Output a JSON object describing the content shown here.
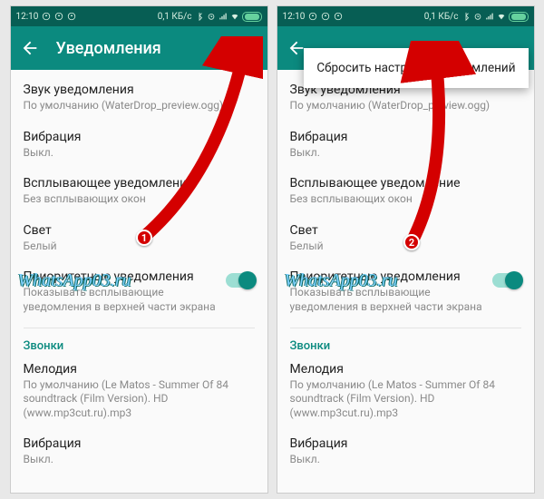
{
  "statusbar": {
    "time": "12:10",
    "network": "0,1 КБ/с"
  },
  "appbar": {
    "title": "Уведомления",
    "menu_reset": "Сбросить настройки уведомлений"
  },
  "items": {
    "sound_title": "Звук уведомления",
    "sound_sub": "По умолчанию (WaterDrop_preview.ogg)",
    "vibration_title": "Вибрация",
    "vibration_sub": "Выкл.",
    "popup_title": "Всплывающее уведомление",
    "popup_sub": "Без всплывающих окон",
    "light_title": "Свет",
    "light_sub": "Белый",
    "priority_title": "Приоритетные уведомления",
    "priority_sub": "Показывать всплывающие уведомления в верхней части экрана",
    "section_calls": "Звонки",
    "ringtone_title": "Мелодия",
    "ringtone_sub": "По умолчанию (Le Matos - Summer Of 84 soundtrack (Film Version). HD (www.mp3cut.ru).mp3",
    "vibration2_title": "Вибрация",
    "vibration2_sub": "Выкл."
  },
  "watermark": "WhatsApp03.ru",
  "annotations": {
    "badge1": "1",
    "badge2": "2"
  }
}
